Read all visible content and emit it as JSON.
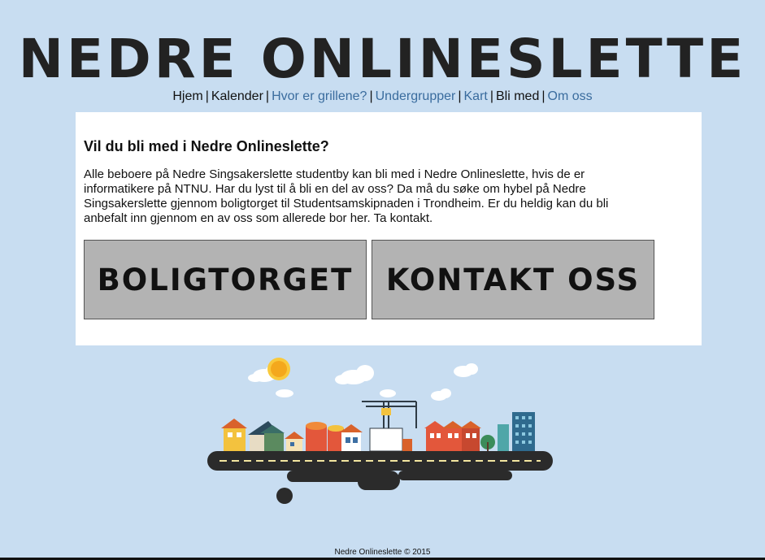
{
  "header": {
    "title": "NEDRE ONLINESLETTE"
  },
  "nav": {
    "items": [
      {
        "label": "Hjem",
        "link": false
      },
      {
        "label": "Kalender",
        "link": false
      },
      {
        "label": "Hvor er grillene?",
        "link": true
      },
      {
        "label": "Undergrupper",
        "link": true
      },
      {
        "label": "Kart",
        "link": true
      },
      {
        "label": "Bli med",
        "link": false
      },
      {
        "label": "Om oss",
        "link": true
      }
    ],
    "separator": "|"
  },
  "main": {
    "heading": "Vil du bli med i Nedre Onlineslette?",
    "body": "Alle beboere på Nedre Singsakerslette studentby kan bli med i Nedre Onlineslette, hvis de er informatikere på NTNU. Har du lyst til å bli en del av oss? Da må du søke om hybel på Nedre Singsakerslette gjennom boligtorget til Studentsamskipnaden i Trondheim. Er du heldig kan du bli anbefalt inn gjennom en av oss som allerede bor her. Ta kontakt.",
    "buttons": {
      "boligtorget": "BOLIGTORGET",
      "kontakt": "KONTAKT OSS"
    }
  },
  "illustration": {
    "name": "city-street-illustration"
  },
  "footer": {
    "text": "Nedre Onlineslette © 2015"
  },
  "colors": {
    "background": "#c8ddf1",
    "link": "#3a6c9e",
    "button": "#b3b3b3",
    "title": "#222222"
  }
}
